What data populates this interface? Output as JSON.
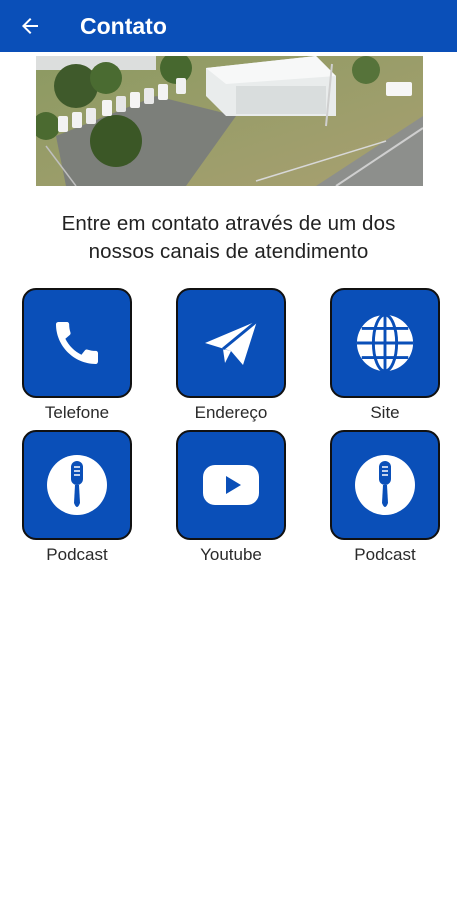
{
  "colors": {
    "primary": "#0a4fb8",
    "icon": "#ffffff"
  },
  "header": {
    "title": "Contato",
    "back_icon": "arrow-left-icon"
  },
  "intro": {
    "line1": "Entre em contato através de um dos",
    "line2": "nossos canais de atendimento"
  },
  "channels": [
    {
      "label": "Telefone",
      "icon": "phone-icon"
    },
    {
      "label": "Endereço",
      "icon": "paper-plane-icon"
    },
    {
      "label": "Site",
      "icon": "globe-icon"
    },
    {
      "label": "Podcast",
      "icon": "microphone-icon"
    },
    {
      "label": "Youtube",
      "icon": "youtube-icon"
    },
    {
      "label": "Podcast",
      "icon": "microphone-icon"
    }
  ]
}
